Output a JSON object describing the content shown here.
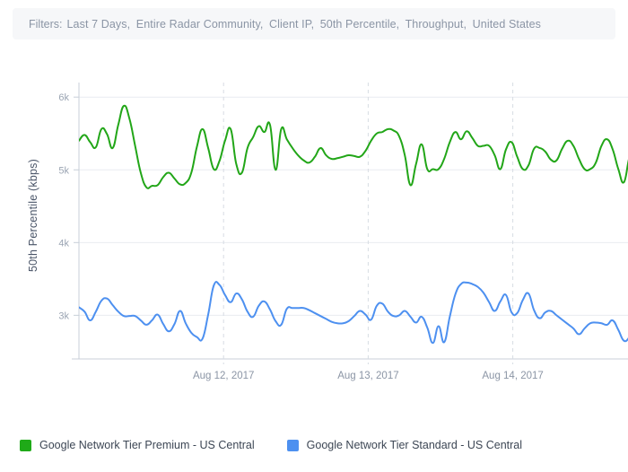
{
  "filters": {
    "label": "Filters:",
    "items": [
      "Last 7 Days,",
      "Entire Radar Community,",
      "Client IP,",
      "50th Percentile,",
      "Throughput,",
      "United States"
    ]
  },
  "legend": {
    "items": [
      {
        "label": "Google Network Tier Premium - US Central",
        "color": "#1faa18",
        "icon": "square-swatch"
      },
      {
        "label": "Google Network Tier Standard - US Central",
        "color": "#4d90f0",
        "icon": "square-swatch"
      }
    ]
  },
  "chart_data": {
    "type": "line",
    "title": "",
    "xlabel": "",
    "ylabel": "50th Percentile (kbps)",
    "ylim": [
      2400,
      6200
    ],
    "yticks": [
      3000,
      4000,
      5000,
      6000
    ],
    "ytick_labels": [
      "3k",
      "4k",
      "5k",
      "6k"
    ],
    "xlim": [
      0,
      100
    ],
    "xticks": [
      26,
      52,
      78
    ],
    "xtick_labels": [
      "Aug 12, 2017",
      "Aug 13, 2017",
      "Aug 14, 2017"
    ],
    "grid": "vertical-dashed-and-horizontal-solid",
    "legend_position": "bottom-left",
    "series": [
      {
        "name": "Google Network Tier Premium - US Central",
        "color": "#22a618",
        "values": [
          5400,
          5480,
          5380,
          5310,
          5560,
          5490,
          5300,
          5620,
          5880,
          5700,
          5330,
          4960,
          4760,
          4780,
          4790,
          4900,
          4960,
          4880,
          4800,
          4820,
          4960,
          5320,
          5560,
          5300,
          5010,
          5120,
          5400,
          5560,
          5080,
          4960,
          5300,
          5450,
          5600,
          5520,
          5620,
          5000,
          5560,
          5420,
          5300,
          5200,
          5130,
          5100,
          5180,
          5300,
          5200,
          5150,
          5160,
          5180,
          5200,
          5190,
          5180,
          5260,
          5400,
          5500,
          5520,
          5560,
          5540,
          5460,
          5200,
          4790,
          5080,
          5350,
          5010,
          5010,
          5010,
          5150,
          5380,
          5520,
          5420,
          5530,
          5440,
          5330,
          5330,
          5330,
          5200,
          5010,
          5280,
          5380,
          5180,
          5010,
          5060,
          5290,
          5300,
          5250,
          5140,
          5130,
          5290,
          5400,
          5330,
          5150,
          5010,
          5010,
          5100,
          5330,
          5420,
          5280,
          5010,
          4830,
          5180,
          5300
        ]
      },
      {
        "name": "Google Network Tier Standard - US Central",
        "color": "#4d90f0",
        "values": [
          3110,
          3050,
          2930,
          3050,
          3200,
          3230,
          3140,
          3050,
          2990,
          2990,
          2990,
          2930,
          2870,
          2930,
          3010,
          2880,
          2780,
          2880,
          3060,
          2890,
          2760,
          2700,
          2680,
          3010,
          3410,
          3420,
          3280,
          3180,
          3300,
          3220,
          3050,
          2980,
          3130,
          3190,
          3080,
          2920,
          2870,
          3090,
          3100,
          3100,
          3100,
          3070,
          3030,
          2990,
          2950,
          2910,
          2890,
          2890,
          2920,
          2990,
          3060,
          3010,
          2940,
          3130,
          3160,
          3050,
          2990,
          3000,
          3060,
          2980,
          2900,
          2980,
          2830,
          2620,
          2850,
          2630,
          2980,
          3290,
          3430,
          3450,
          3430,
          3390,
          3310,
          3180,
          3060,
          3190,
          3280,
          3040,
          3030,
          3210,
          3300,
          3070,
          2960,
          3040,
          3060,
          3000,
          2940,
          2880,
          2820,
          2740,
          2820,
          2890,
          2900,
          2890,
          2870,
          2930,
          2800,
          2650,
          2700,
          2810
        ]
      }
    ]
  }
}
